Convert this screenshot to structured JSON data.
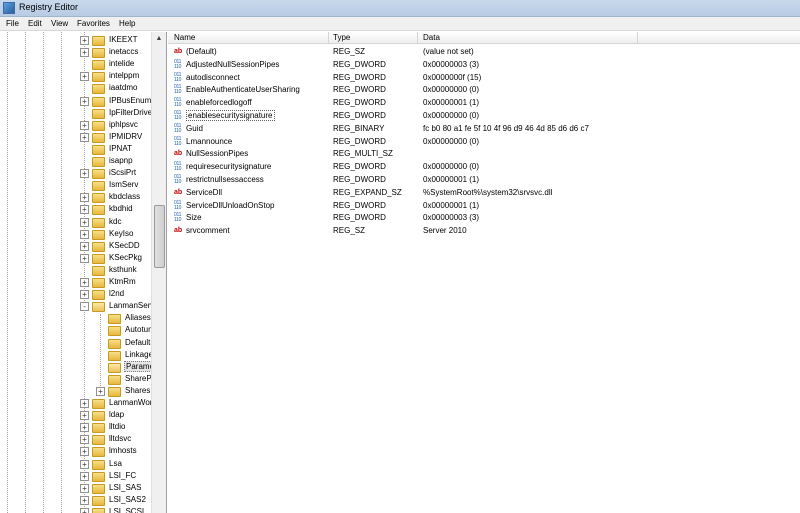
{
  "window": {
    "title": "Registry Editor"
  },
  "menu": [
    "File",
    "Edit",
    "View",
    "Favorites",
    "Help"
  ],
  "tree": {
    "items": [
      {
        "label": "IKEEXT",
        "level": 1,
        "expander": "+"
      },
      {
        "label": "inetaccs",
        "level": 1,
        "expander": "+"
      },
      {
        "label": "intelide",
        "level": 1,
        "expander": ""
      },
      {
        "label": "intelppm",
        "level": 1,
        "expander": "+"
      },
      {
        "label": "iaatdmo",
        "level": 1,
        "expander": ""
      },
      {
        "label": "IPBusEnum",
        "level": 1,
        "expander": "+"
      },
      {
        "label": "IpFilterDrive",
        "level": 1,
        "expander": ""
      },
      {
        "label": "iphlpsvc",
        "level": 1,
        "expander": "+"
      },
      {
        "label": "IPMIDRV",
        "level": 1,
        "expander": "+"
      },
      {
        "label": "IPNAT",
        "level": 1,
        "expander": ""
      },
      {
        "label": "isapnp",
        "level": 1,
        "expander": ""
      },
      {
        "label": "iScsiPrt",
        "level": 1,
        "expander": "+"
      },
      {
        "label": "IsmServ",
        "level": 1,
        "expander": ""
      },
      {
        "label": "kbdclass",
        "level": 1,
        "expander": "+"
      },
      {
        "label": "kbdhid",
        "level": 1,
        "expander": "+"
      },
      {
        "label": "kdc",
        "level": 1,
        "expander": "+"
      },
      {
        "label": "KeyIso",
        "level": 1,
        "expander": "+"
      },
      {
        "label": "KSecDD",
        "level": 1,
        "expander": "+"
      },
      {
        "label": "KSecPkg",
        "level": 1,
        "expander": "+"
      },
      {
        "label": "ksthunk",
        "level": 1,
        "expander": ""
      },
      {
        "label": "KtmRm",
        "level": 1,
        "expander": "+"
      },
      {
        "label": "l2nd",
        "level": 1,
        "expander": "+"
      },
      {
        "label": "LanmanServ",
        "level": 1,
        "expander": "-",
        "open": true
      },
      {
        "label": "Aliases",
        "level": 2,
        "expander": ""
      },
      {
        "label": "Autotun",
        "level": 2,
        "expander": ""
      },
      {
        "label": "DefaultS",
        "level": 2,
        "expander": ""
      },
      {
        "label": "Linkage",
        "level": 2,
        "expander": ""
      },
      {
        "label": "Paramet",
        "level": 2,
        "expander": "",
        "selected": true,
        "open": true
      },
      {
        "label": "SharePro",
        "level": 2,
        "expander": ""
      },
      {
        "label": "Shares",
        "level": 2,
        "expander": "+"
      },
      {
        "label": "LanmanWorl",
        "level": 1,
        "expander": "+"
      },
      {
        "label": "ldap",
        "level": 1,
        "expander": "+"
      },
      {
        "label": "lltdio",
        "level": 1,
        "expander": "+"
      },
      {
        "label": "lltdsvc",
        "level": 1,
        "expander": "+"
      },
      {
        "label": "lmhosts",
        "level": 1,
        "expander": "+"
      },
      {
        "label": "Lsa",
        "level": 1,
        "expander": "+"
      },
      {
        "label": "LSI_FC",
        "level": 1,
        "expander": "+"
      },
      {
        "label": "LSI_SAS",
        "level": 1,
        "expander": "+"
      },
      {
        "label": "LSI_SAS2",
        "level": 1,
        "expander": "+"
      },
      {
        "label": "LSI_SCSI",
        "level": 1,
        "expander": "+"
      }
    ]
  },
  "list": {
    "columns": [
      "Name",
      "Type",
      "Data"
    ],
    "rows": [
      {
        "name": "(Default)",
        "type": "REG_SZ",
        "data": "(value not set)",
        "icon": "string-value-icon"
      },
      {
        "name": "AdjustedNullSessionPipes",
        "type": "REG_DWORD",
        "data": "0x00000003 (3)",
        "icon": "binary-value-icon"
      },
      {
        "name": "autodisconnect",
        "type": "REG_DWORD",
        "data": "0x0000000f (15)",
        "icon": "binary-value-icon"
      },
      {
        "name": "EnableAuthenticateUserSharing",
        "type": "REG_DWORD",
        "data": "0x00000000 (0)",
        "icon": "binary-value-icon"
      },
      {
        "name": "enableforcedlogoff",
        "type": "REG_DWORD",
        "data": "0x00000001 (1)",
        "icon": "binary-value-icon"
      },
      {
        "name": "enablesecuritysignature",
        "type": "REG_DWORD",
        "data": "0x00000000 (0)",
        "icon": "binary-value-icon",
        "focused": true
      },
      {
        "name": "Guid",
        "type": "REG_BINARY",
        "data": "fc b0 80 a1 fe 5f 10 4f 96 d9 46 4d 85 d6 d6 c7",
        "icon": "binary-value-icon"
      },
      {
        "name": "Lmannounce",
        "type": "REG_DWORD",
        "data": "0x00000000 (0)",
        "icon": "binary-value-icon"
      },
      {
        "name": "NullSessionPipes",
        "type": "REG_MULTI_SZ",
        "data": "",
        "icon": "string-value-icon"
      },
      {
        "name": "requiresecuritysignature",
        "type": "REG_DWORD",
        "data": "0x00000000 (0)",
        "icon": "binary-value-icon"
      },
      {
        "name": "restrictnullsessaccess",
        "type": "REG_DWORD",
        "data": "0x00000001 (1)",
        "icon": "binary-value-icon"
      },
      {
        "name": "ServiceDll",
        "type": "REG_EXPAND_SZ",
        "data": "%SystemRoot%\\system32\\srvsvc.dll",
        "icon": "string-value-icon"
      },
      {
        "name": "ServiceDllUnloadOnStop",
        "type": "REG_DWORD",
        "data": "0x00000001 (1)",
        "icon": "binary-value-icon"
      },
      {
        "name": "Size",
        "type": "REG_DWORD",
        "data": "0x00000003 (3)",
        "icon": "binary-value-icon"
      },
      {
        "name": "srvcomment",
        "type": "REG_SZ",
        "data": "Server 2010",
        "icon": "string-value-icon"
      }
    ]
  }
}
